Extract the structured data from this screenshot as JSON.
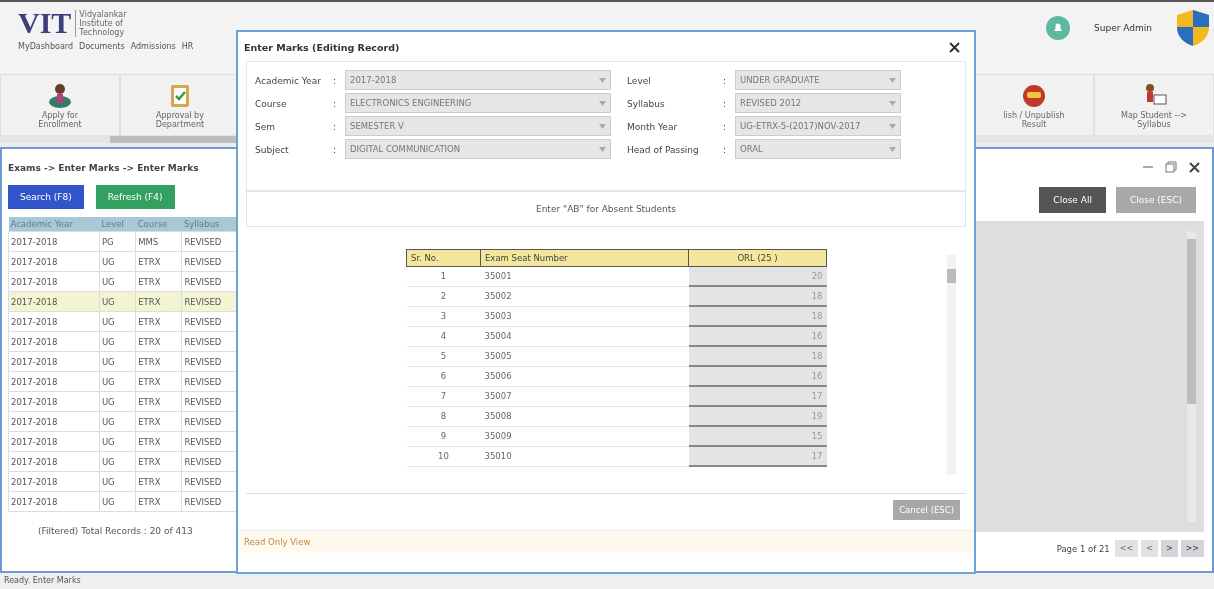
{
  "logo": {
    "mark": "VIT",
    "tagline": "Vidyalankar Institute of Technology"
  },
  "menu": [
    "MyDashboard",
    "Documents",
    "Admissions",
    "HR"
  ],
  "user": {
    "name": "Super Admin"
  },
  "toolbar_left": [
    {
      "label": "Apply for Enrollment",
      "kind": "person"
    },
    {
      "label": "Approval by Department",
      "kind": "clipboard"
    }
  ],
  "toolbar_right": [
    {
      "label": "lish / Unpublish Result",
      "kind": "badge"
    },
    {
      "label": "Map Student --> Syllabus",
      "kind": "teacher"
    }
  ],
  "inner_window": {
    "breadcrumb": "Exams -> Enter Marks -> Enter Marks",
    "buttons": [
      {
        "label": "Search (F8)",
        "kind": "search"
      },
      {
        "label": "Refresh (F4)",
        "kind": "refresh"
      }
    ],
    "right_buttons": [
      {
        "label": "Close All",
        "disabled": false
      },
      {
        "label": "Close (ESC)",
        "disabled": true
      }
    ],
    "table": {
      "columns": [
        "Academic Year",
        "Level",
        "Course",
        "Syllabus"
      ],
      "rows": [
        {
          "cells": [
            "2017-2018",
            "PG",
            "MMS",
            "REVISED"
          ],
          "selected": false
        },
        {
          "cells": [
            "2017-2018",
            "UG",
            "ETRX",
            "REVISED"
          ],
          "selected": false
        },
        {
          "cells": [
            "2017-2018",
            "UG",
            "ETRX",
            "REVISED"
          ],
          "selected": false
        },
        {
          "cells": [
            "2017-2018",
            "UG",
            "ETRX",
            "REVISED"
          ],
          "selected": true
        },
        {
          "cells": [
            "2017-2018",
            "UG",
            "ETRX",
            "REVISED"
          ],
          "selected": false
        },
        {
          "cells": [
            "2017-2018",
            "UG",
            "ETRX",
            "REVISED"
          ],
          "selected": false
        },
        {
          "cells": [
            "2017-2018",
            "UG",
            "ETRX",
            "REVISED"
          ],
          "selected": false
        },
        {
          "cells": [
            "2017-2018",
            "UG",
            "ETRX",
            "REVISED"
          ],
          "selected": false
        },
        {
          "cells": [
            "2017-2018",
            "UG",
            "ETRX",
            "REVISED"
          ],
          "selected": false
        },
        {
          "cells": [
            "2017-2018",
            "UG",
            "ETRX",
            "REVISED"
          ],
          "selected": false
        },
        {
          "cells": [
            "2017-2018",
            "UG",
            "ETRX",
            "REVISED"
          ],
          "selected": false
        },
        {
          "cells": [
            "2017-2018",
            "UG",
            "ETRX",
            "REVISED"
          ],
          "selected": false
        },
        {
          "cells": [
            "2017-2018",
            "UG",
            "ETRX",
            "REVISED"
          ],
          "selected": false
        },
        {
          "cells": [
            "2017-2018",
            "UG",
            "ETRX",
            "REVISED"
          ],
          "selected": false
        }
      ]
    },
    "total": "(Filtered) Total Records : 20 of 413",
    "page": "Page 1 of 21",
    "pager": [
      {
        "label": "<<",
        "disabled": true
      },
      {
        "label": "<",
        "disabled": true
      },
      {
        "label": ">",
        "disabled": false
      },
      {
        "label": ">>",
        "disabled": false
      }
    ]
  },
  "dialog": {
    "title": "Enter Marks (Editing Record)",
    "fields": [
      {
        "label": "Academic Year",
        "separator": ":",
        "value": "2017-2018",
        "disabled": true
      },
      {
        "label": "Level",
        "separator": ":",
        "value": "UNDER GRADUATE",
        "disabled": true
      },
      {
        "label": "Course",
        "separator": ":",
        "value": "ELECTRONICS ENGINEERING",
        "disabled": true
      },
      {
        "label": "Syllabus",
        "separator": ":",
        "value": "REVISED 2012",
        "disabled": true
      },
      {
        "label": "Sem",
        "separator": ":",
        "value": "SEMESTER V",
        "disabled": true
      },
      {
        "label": "Month Year",
        "separator": ":",
        "value": "UG-ETRX-5-(2017)NOV-2017",
        "disabled": true
      },
      {
        "label": "Subject",
        "separator": ":",
        "value": "DIGITAL COMMUNICATION",
        "disabled": true
      },
      {
        "label": "Head of Passing",
        "separator": ":",
        "value": "ORAL",
        "disabled": true
      }
    ],
    "notice": "Enter \"AB\" for Absent Students",
    "columns": [
      "Sr. No.",
      "Exam Seat Number",
      "ORL (25 )"
    ],
    "rows": [
      [
        "1",
        "35001",
        "20"
      ],
      [
        "2",
        "35002",
        "18"
      ],
      [
        "3",
        "35003",
        "18"
      ],
      [
        "4",
        "35004",
        "16"
      ],
      [
        "5",
        "35005",
        "18"
      ],
      [
        "6",
        "35006",
        "16"
      ],
      [
        "7",
        "35007",
        "17"
      ],
      [
        "8",
        "35008",
        "19"
      ],
      [
        "9",
        "35009",
        "15"
      ],
      [
        "10",
        "35010",
        "17"
      ]
    ],
    "cancel": "Cancel (ESC)",
    "footer": "Read Only View"
  },
  "status_bar": "Ready. Enter Marks"
}
